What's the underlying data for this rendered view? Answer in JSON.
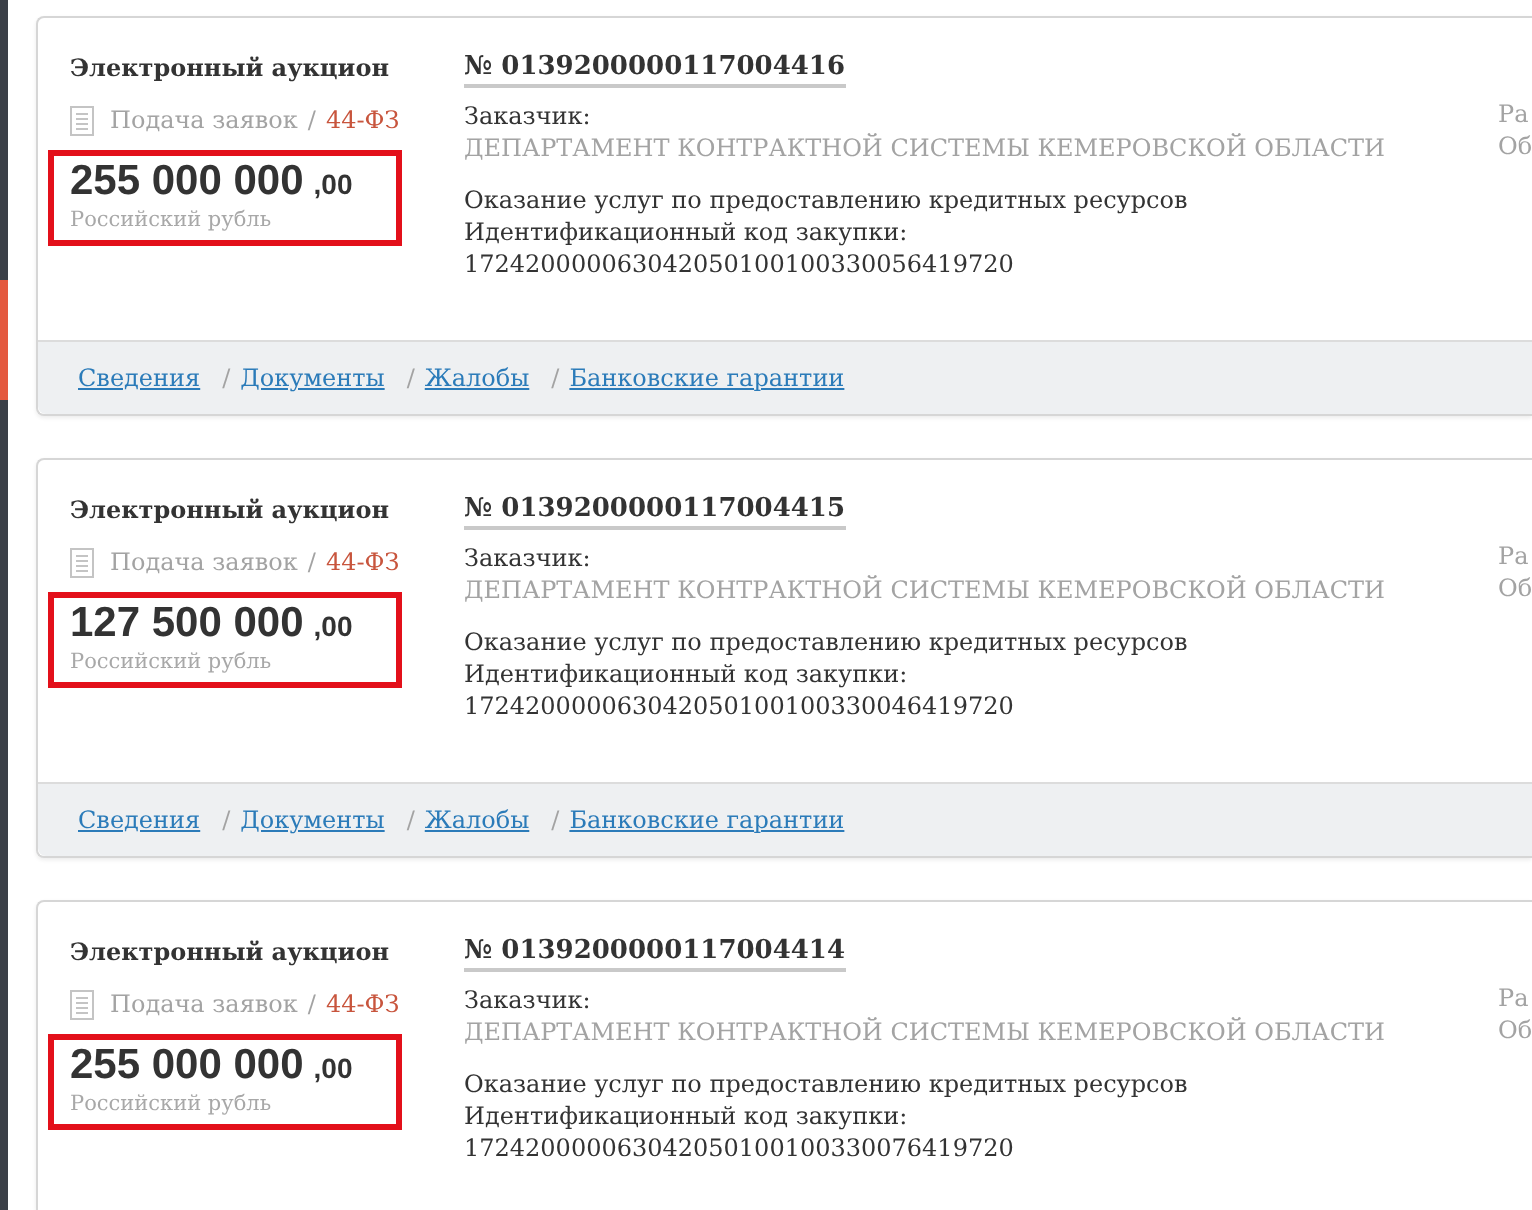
{
  "cards": [
    {
      "type": "Электронный аукцион",
      "stage": "Подача заявок",
      "separator": "/",
      "law": "44-ФЗ",
      "highlighted": true,
      "price": "255 000 000",
      "cents": ",00",
      "currency": "Российский рубль",
      "number": "№ 0139200000117004416",
      "customer_label": "Заказчик:",
      "customer": "ДЕПАРТАМЕНТ КОНТРАКТНОЙ СИСТЕМЫ КЕМЕРОВСКОЙ ОБЛАСТИ",
      "description": "Оказание услуг по предоставлению кредитных ресурсов",
      "code_label": "Идентификационный код закупки:",
      "code": "172420000063042050100100330056419720",
      "column_3": [
        "Ра",
        "Об"
      ],
      "links": [
        {
          "label": "Сведения"
        },
        {
          "separator": "/",
          "label": "Документы"
        },
        {
          "separator": "/",
          "label": "Жалобы"
        },
        {
          "separator": "/",
          "label": "Банковские гарантии"
        }
      ]
    },
    {
      "type": "Электронный аукцион",
      "stage": "Подача заявок",
      "separator": "/",
      "law": "44-ФЗ",
      "highlighted": true,
      "price": "127 500 000",
      "cents": ",00",
      "currency": "Российский рубль",
      "number": "№ 0139200000117004415",
      "customer_label": "Заказчик:",
      "customer": "ДЕПАРТАМЕНТ КОНТРАКТНОЙ СИСТЕМЫ КЕМЕРОВСКОЙ ОБЛАСТИ",
      "description": "Оказание услуг по предоставлению кредитных ресурсов",
      "code_label": "Идентификационный код закупки:",
      "code": "172420000063042050100100330046419720",
      "column_3": [
        "Ра",
        "Об"
      ],
      "links": [
        {
          "label": "Сведения"
        },
        {
          "separator": "/",
          "label": "Документы"
        },
        {
          "separator": "/",
          "label": "Жалобы"
        },
        {
          "separator": "/",
          "label": "Банковские гарантии"
        }
      ]
    },
    {
      "type": "Электронный аукцион",
      "stage": "Подача заявок",
      "separator": "/",
      "law": "44-ФЗ",
      "highlighted": true,
      "price": "255 000 000",
      "cents": ",00",
      "currency": "Российский рубль",
      "number": "№ 0139200000117004414",
      "customer_label": "Заказчик:",
      "customer": "ДЕПАРТАМЕНТ КОНТРАКТНОЙ СИСТЕМЫ КЕМЕРОВСКОЙ ОБЛАСТИ",
      "description": "Оказание услуг по предоставлению кредитных ресурсов",
      "code_label": "Идентификационный код закупки:",
      "code": "172420000063042050100100330076419720",
      "column_3": [
        "Ра",
        "Об"
      ]
    }
  ]
}
